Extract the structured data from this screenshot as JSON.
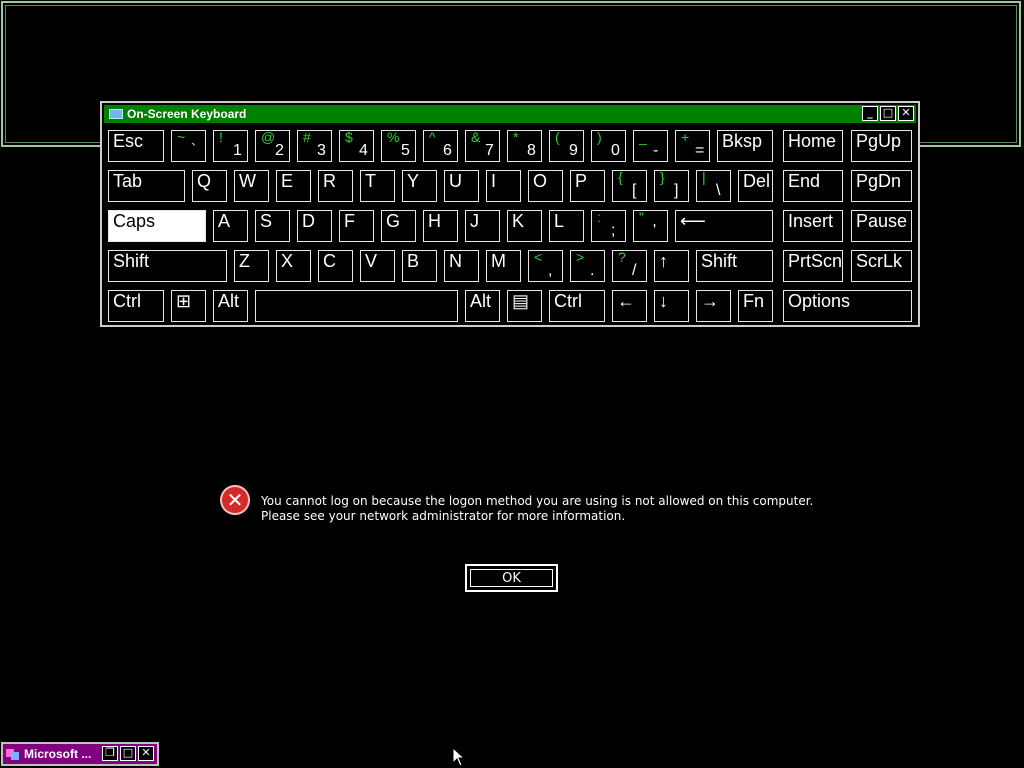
{
  "osk": {
    "title": "On-Screen Keyboard",
    "title_icon": "keyboard-icon",
    "controls": [
      "minimize",
      "maximize",
      "close"
    ],
    "rows": [
      [
        {
          "label": "Esc"
        },
        {
          "shift": "~",
          "label": "`"
        },
        {
          "shift": "!",
          "label": "1"
        },
        {
          "shift": "@",
          "label": "2"
        },
        {
          "shift": "#",
          "label": "3"
        },
        {
          "shift": "$",
          "label": "4"
        },
        {
          "shift": "%",
          "label": "5"
        },
        {
          "shift": "^",
          "label": "6"
        },
        {
          "shift": "&",
          "label": "7"
        },
        {
          "shift": "*",
          "label": "8"
        },
        {
          "shift": "(",
          "label": "9"
        },
        {
          "shift": ")",
          "label": "0"
        },
        {
          "shift": "_",
          "label": "-"
        },
        {
          "shift": "+",
          "label": "="
        },
        {
          "label": "Bksp"
        },
        {
          "label": "Home"
        },
        {
          "label": "PgUp"
        }
      ],
      [
        {
          "label": "Tab"
        },
        {
          "label": "Q"
        },
        {
          "label": "W"
        },
        {
          "label": "E"
        },
        {
          "label": "R"
        },
        {
          "label": "T"
        },
        {
          "label": "Y"
        },
        {
          "label": "U"
        },
        {
          "label": "I"
        },
        {
          "label": "O"
        },
        {
          "label": "P"
        },
        {
          "shift": "{",
          "label": "["
        },
        {
          "shift": "}",
          "label": "]"
        },
        {
          "shift": "|",
          "label": "\\"
        },
        {
          "label": "Del"
        },
        {
          "label": "End"
        },
        {
          "label": "PgDn"
        }
      ],
      [
        {
          "label": "Caps",
          "active": true
        },
        {
          "label": "A"
        },
        {
          "label": "S"
        },
        {
          "label": "D"
        },
        {
          "label": "F"
        },
        {
          "label": "G"
        },
        {
          "label": "H"
        },
        {
          "label": "J"
        },
        {
          "label": "K"
        },
        {
          "label": "L"
        },
        {
          "shift": ":",
          "label": ";"
        },
        {
          "shift": "\"",
          "label": "'"
        },
        {
          "label": "⟵",
          "icon": "enter-icon"
        },
        {
          "label": "Insert"
        },
        {
          "label": "Pause"
        }
      ],
      [
        {
          "label": "Shift"
        },
        {
          "label": "Z"
        },
        {
          "label": "X"
        },
        {
          "label": "C"
        },
        {
          "label": "V"
        },
        {
          "label": "B"
        },
        {
          "label": "N"
        },
        {
          "label": "M"
        },
        {
          "shift": "<",
          "label": ","
        },
        {
          "shift": ">",
          "label": "."
        },
        {
          "shift": "?",
          "label": "/"
        },
        {
          "label": "↑",
          "icon": "up-arrow-icon"
        },
        {
          "label": "Shift"
        },
        {
          "label": "PrtScn"
        },
        {
          "label": "ScrLk"
        }
      ],
      [
        {
          "label": "Ctrl"
        },
        {
          "label": "⊞",
          "icon": "windows-logo-icon"
        },
        {
          "label": "Alt"
        },
        {
          "label": "",
          "icon": "spacebar"
        },
        {
          "label": "Alt"
        },
        {
          "label": "▤",
          "icon": "menu-key-icon"
        },
        {
          "label": "Ctrl"
        },
        {
          "label": "←",
          "icon": "left-arrow-icon"
        },
        {
          "label": "↓",
          "icon": "down-arrow-icon"
        },
        {
          "label": "→",
          "icon": "right-arrow-icon"
        },
        {
          "label": "Fn"
        },
        {
          "label": "Options"
        }
      ]
    ]
  },
  "dialog": {
    "icon": "error-icon",
    "message": "You cannot log on because the logon method you are using is not allowed on this computer. Please see your network administrator for more information.",
    "ok_label": "OK"
  },
  "minimized_window": {
    "title": "Microsoft ...",
    "icon": "app-icon",
    "controls": [
      "restore",
      "maximize",
      "close"
    ]
  },
  "colors": {
    "background": "#000000",
    "titlebar": "#008000",
    "shift_char": "#2fd02f",
    "minimized_titlebar": "#800080",
    "error": "#d42a2a"
  }
}
